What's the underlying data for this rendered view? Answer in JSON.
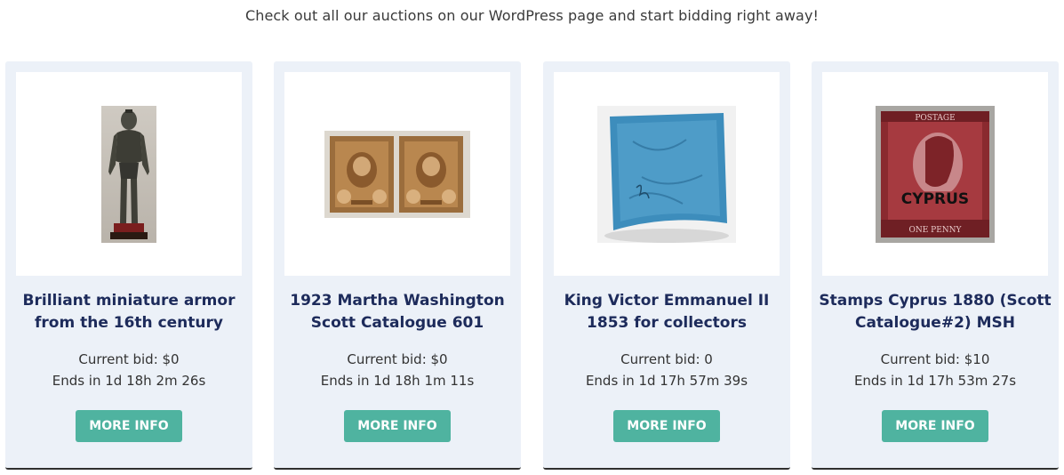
{
  "intro_text": "Check out all our auctions on our WordPress page and start bidding right away!",
  "cards": [
    {
      "title": "Brilliant miniature armor from the 16th century",
      "current_bid": "Current bid: $0",
      "ends": "Ends in 1d 18h 2m 26s",
      "button": "MORE INFO",
      "image": "armor-photo"
    },
    {
      "title": "1923 Martha Washington Scott Catalogue 601",
      "current_bid": "Current bid: $0",
      "ends": "Ends in 1d 18h 1m 11s",
      "button": "MORE INFO",
      "image": "washington-stamps-photo"
    },
    {
      "title": "King Victor Emmanuel II 1853 for collectors",
      "current_bid": "Current bid: 0",
      "ends": "Ends in 1d 17h 57m 39s",
      "button": "MORE INFO",
      "image": "blue-stamp-photo"
    },
    {
      "title": "Stamps Cyprus 1880 (Scott Catalogue#2) MSH",
      "current_bid": "Current bid: $10",
      "ends": "Ends in 1d 17h 53m 27s",
      "button": "MORE INFO",
      "image": "cyprus-stamp-photo"
    }
  ],
  "colors": {
    "card_bg": "#ecf1f8",
    "title": "#1d2b5b",
    "button": "#4fb3a0"
  }
}
